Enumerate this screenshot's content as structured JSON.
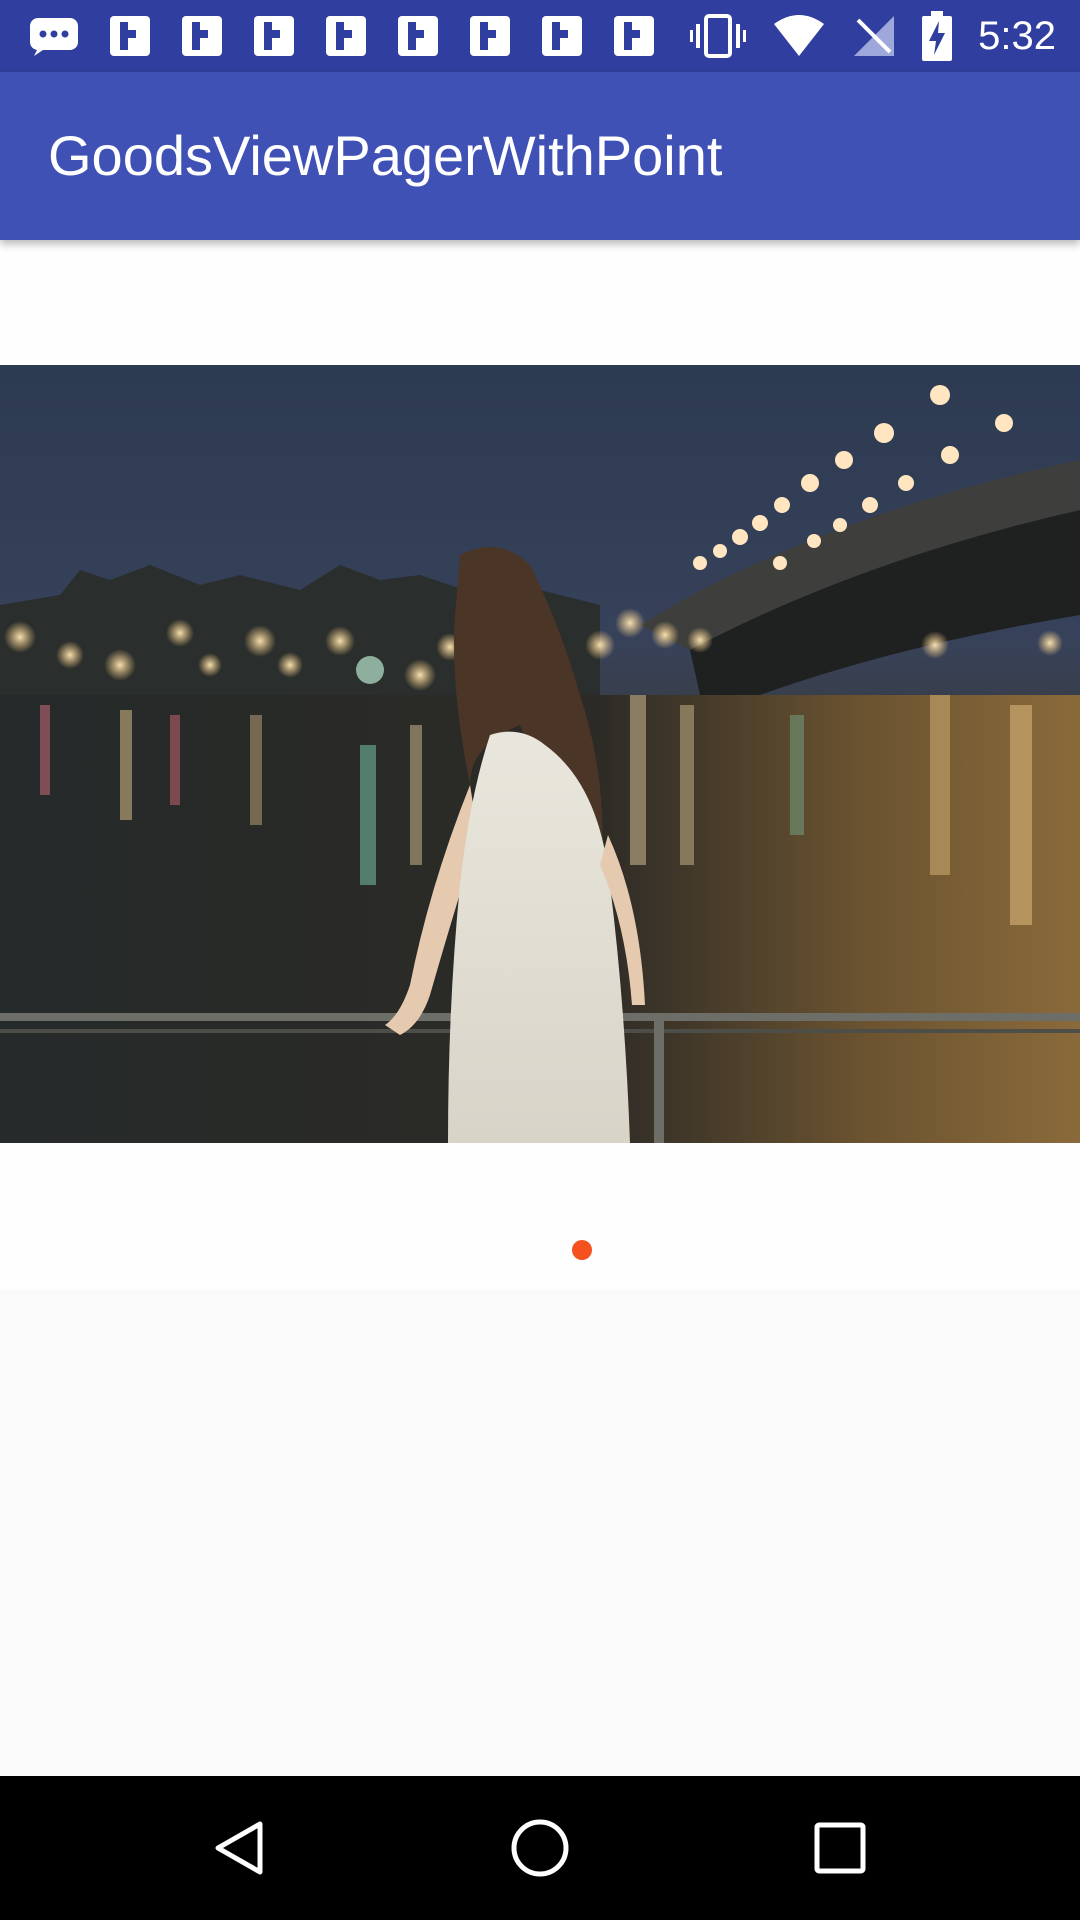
{
  "status_bar": {
    "time": "5:32",
    "left_icons": [
      "chat-icon",
      "flipboard-icon",
      "flipboard-icon",
      "flipboard-icon",
      "flipboard-icon",
      "flipboard-icon",
      "flipboard-icon",
      "flipboard-icon",
      "flipboard-icon"
    ],
    "right_icons": [
      "vibrate-icon",
      "wifi-icon",
      "no-signal-icon",
      "battery-charging-icon"
    ]
  },
  "app_bar": {
    "title": "GoodsViewPagerWithPoint"
  },
  "pager": {
    "page_count": 1,
    "current_page": 1,
    "indicator_color": "#f4511e"
  },
  "nav_bar": {
    "buttons": [
      "back-icon",
      "home-icon",
      "recents-icon"
    ]
  },
  "colors": {
    "status_bar": "#303f9f",
    "app_bar": "#3f51b5",
    "background": "#fafafa",
    "accent": "#f4511e"
  }
}
